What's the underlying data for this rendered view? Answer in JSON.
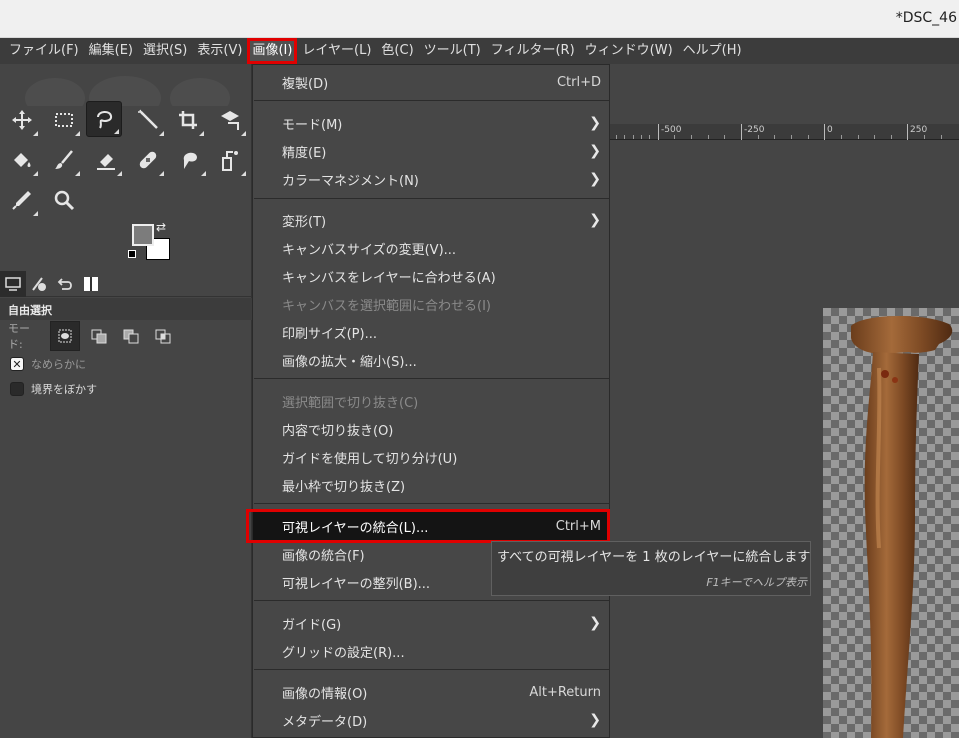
{
  "window": {
    "title": "*DSC_46"
  },
  "menubar": [
    {
      "label": "ファイル(F)"
    },
    {
      "label": "編集(E)"
    },
    {
      "label": "選択(S)"
    },
    {
      "label": "表示(V)"
    },
    {
      "label": "画像(I)",
      "active": true
    },
    {
      "label": "レイヤー(L)"
    },
    {
      "label": "色(C)"
    },
    {
      "label": "ツール(T)"
    },
    {
      "label": "フィルター(R)"
    },
    {
      "label": "ウィンドウ(W)"
    },
    {
      "label": "ヘルプ(H)"
    }
  ],
  "tool_options": {
    "title": "自由選択",
    "mode_label": "モード:",
    "antialias_label": "なめらかに",
    "feather_label": "境界をぼかす"
  },
  "ruler": {
    "labels": [
      "-500",
      "-250",
      "0",
      "250"
    ]
  },
  "image_menu": {
    "items": [
      {
        "label": "複製(D)",
        "shortcut": "Ctrl+D"
      },
      {
        "label": "モード(M)",
        "submenu": true
      },
      {
        "label": "精度(E)",
        "submenu": true
      },
      {
        "label": "カラーマネジメント(N)",
        "submenu": true
      },
      {
        "label": "変形(T)",
        "submenu": true
      },
      {
        "label": "キャンバスサイズの変更(V)..."
      },
      {
        "label": "キャンバスをレイヤーに合わせる(A)"
      },
      {
        "label": "キャンバスを選択範囲に合わせる(I)",
        "disabled": true
      },
      {
        "label": "印刷サイズ(P)..."
      },
      {
        "label": "画像の拡大・縮小(S)..."
      },
      {
        "label": "選択範囲で切り抜き(C)",
        "disabled": true
      },
      {
        "label": "内容で切り抜き(O)"
      },
      {
        "label": "ガイドを使用して切り分け(U)"
      },
      {
        "label": "最小枠で切り抜き(Z)"
      },
      {
        "label": "可視レイヤーの統合(L)...",
        "shortcut": "Ctrl+M",
        "highlighted": true
      },
      {
        "label": "画像の統合(F)"
      },
      {
        "label": "可視レイヤーの整列(B)..."
      },
      {
        "label": "ガイド(G)",
        "submenu": true
      },
      {
        "label": "グリッドの設定(R)..."
      },
      {
        "label": "画像の情報(O)",
        "shortcut": "Alt+Return"
      },
      {
        "label": "メタデータ(D)",
        "submenu": true
      }
    ]
  },
  "tooltip": {
    "text": "すべての可視レイヤーを 1 枚のレイヤーに統合します",
    "help": "F1キーでヘルプ表示"
  },
  "icons": {
    "tools": [
      "move-icon",
      "rect-select-icon",
      "free-select-icon",
      "fuzzy-select-icon",
      "crop-icon",
      "transform-icon",
      "bucket-fill-icon",
      "paintbrush-icon",
      "eraser-icon",
      "heal-icon",
      "smudge-icon",
      "dodge-icon",
      "color-picker-icon",
      "zoom-icon"
    ]
  },
  "colors": {
    "accent_red": "#e00000",
    "foreground": "#7c7c7c",
    "background": "#ffffff"
  }
}
